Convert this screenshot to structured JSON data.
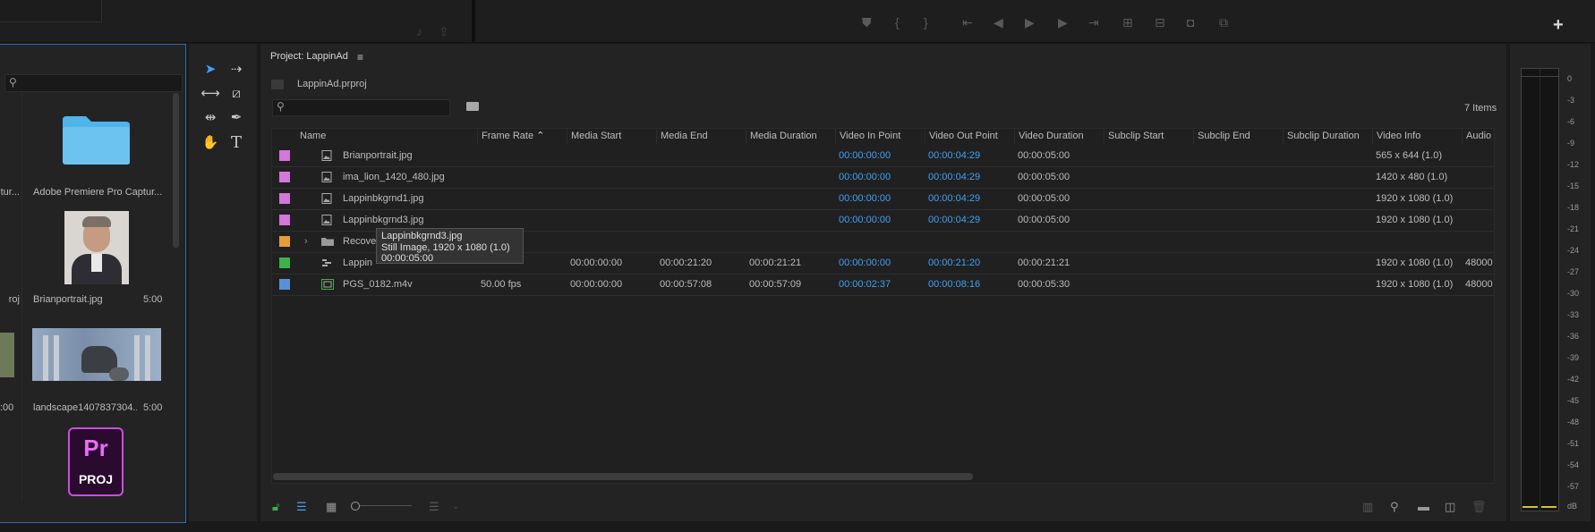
{
  "project": {
    "title": "Project: LappinAd",
    "file_name": "LappinAd.prproj",
    "items_count": "7 Items",
    "columns": [
      "Name",
      "Frame Rate",
      "Media Start",
      "Media End",
      "Media Duration",
      "Video In Point",
      "Video Out Point",
      "Video Duration",
      "Subclip Start",
      "Subclip End",
      "Subclip Duration",
      "Video Info",
      "Audio I"
    ],
    "rows": [
      {
        "color": "#d576db",
        "name": "Brianportrait.jpg",
        "frame_rate": "",
        "media_start": "",
        "media_end": "",
        "media_duration": "",
        "in": "00:00:00:00",
        "out": "00:00:04:29",
        "dur": "00:00:05:00",
        "video_info": "565 x 644 (1.0)",
        "audio": ""
      },
      {
        "color": "#d576db",
        "name": "ima_lion_1420_480.jpg",
        "frame_rate": "",
        "media_start": "",
        "media_end": "",
        "media_duration": "",
        "in": "00:00:00:00",
        "out": "00:00:04:29",
        "dur": "00:00:05:00",
        "video_info": "1420 x 480 (1.0)",
        "audio": ""
      },
      {
        "color": "#d576db",
        "name": "Lappinbkgrnd1.jpg",
        "frame_rate": "",
        "media_start": "",
        "media_end": "",
        "media_duration": "",
        "in": "00:00:00:00",
        "out": "00:00:04:29",
        "dur": "00:00:05:00",
        "video_info": "1920 x 1080 (1.0)",
        "audio": ""
      },
      {
        "color": "#d576db",
        "name": "Lappinbkgrnd3.jpg",
        "frame_rate": "",
        "media_start": "",
        "media_end": "",
        "media_duration": "",
        "in": "00:00:00:00",
        "out": "00:00:04:29",
        "dur": "00:00:05:00",
        "video_info": "1920 x 1080 (1.0)",
        "audio": ""
      },
      {
        "color": "#e89c3a",
        "name": "Recove",
        "frame_rate": "",
        "media_start": "",
        "media_end": "",
        "media_duration": "",
        "in": "",
        "out": "",
        "dur": "",
        "video_info": "",
        "audio": ""
      },
      {
        "color": "#3bb24c",
        "name": "Lappin",
        "frame_rate": "",
        "media_start": "00:00:00:00",
        "media_end": "00:00:21:20",
        "media_duration": "00:00:21:21",
        "in": "00:00:00:00",
        "out": "00:00:21:20",
        "dur": "00:00:21:21",
        "video_info": "1920 x 1080 (1.0)",
        "audio": "48000"
      },
      {
        "color": "#5b8fd6",
        "name": "PGS_0182.m4v",
        "frame_rate": "50.00 fps",
        "media_start": "00:00:00:00",
        "media_end": "00:00:57:08",
        "media_duration": "00:00:57:09",
        "in": "00:00:02:37",
        "out": "00:00:08:16",
        "dur": "00:00:05:30",
        "video_info": "1920 x 1080 (1.0)",
        "audio": "48000"
      }
    ]
  },
  "tooltip": {
    "line1": "Lappinbkgrnd3.jpg",
    "line2": "Still Image, 1920 x 1080 (1.0)",
    "line3": "00:00:05:00"
  },
  "media_browser": {
    "tiles": [
      {
        "name": "tur...",
        "duration": ""
      },
      {
        "name": "Adobe Premiere Pro Captur...",
        "duration": ""
      },
      {
        "name": "roj",
        "duration": ""
      },
      {
        "name": "Brianportrait.jpg",
        "duration": "5:00"
      },
      {
        "name": "",
        "duration": ":00"
      },
      {
        "name": "landscape1407837304...",
        "duration": "5:00"
      },
      {
        "name": "PROJ",
        "duration": ""
      }
    ],
    "pr_logo": "Pr"
  },
  "meter": {
    "labels": [
      "0",
      "-3",
      "-6",
      "-9",
      "-12",
      "-15",
      "-18",
      "-21",
      "-24",
      "-27",
      "-30",
      "-33",
      "-36",
      "-39",
      "-42",
      "-45",
      "-48",
      "-51",
      "-54",
      "-57",
      "dB"
    ]
  },
  "top": {
    "plus_label": "+"
  },
  "colors": {
    "accent_blue": "#3fa2f6",
    "panel": "#232323",
    "highlight_border": "#2b6fb6"
  },
  "icons": [
    "search-icon",
    "selection-tool-icon",
    "track-select-icon",
    "ripple-edit-icon",
    "razor-icon",
    "slip-icon",
    "pen-icon",
    "hand-icon",
    "type-icon",
    "list-view-icon",
    "icon-view-icon",
    "freeform-view-icon",
    "lock-icon",
    "zoom-slider-icon",
    "sort-icon",
    "automate-icon",
    "find-icon",
    "new-bin-icon",
    "new-item-icon",
    "trash-icon",
    "new-search-bin-icon",
    "play-icon",
    "camera-icon",
    "marker-icon"
  ]
}
